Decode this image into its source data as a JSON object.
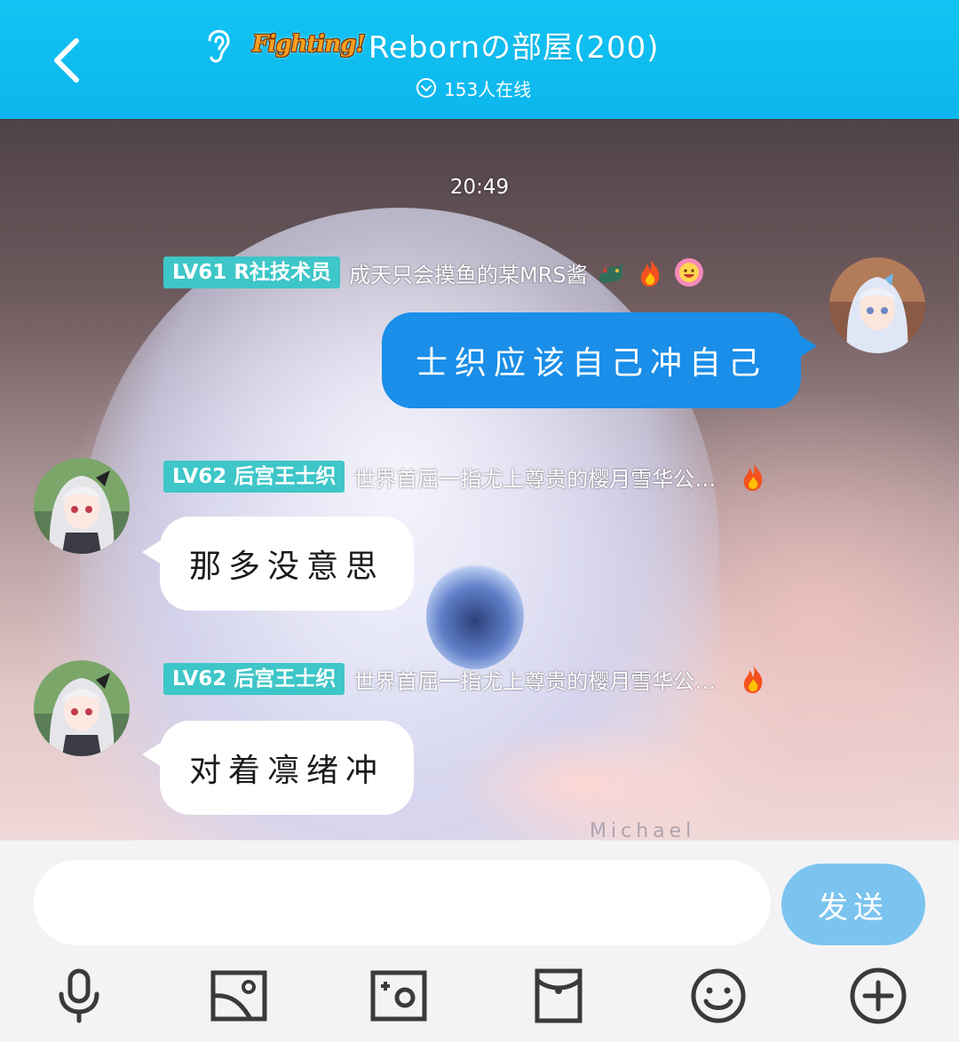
{
  "header": {
    "brand_logo_text": "Fighting!",
    "room_title": "Rebornの部屋(200)",
    "online_count": "153人在线"
  },
  "chat": {
    "timestamp": "20:49",
    "messages": [
      {
        "direction": "outgoing",
        "level": "LV61",
        "title": "R社技术员",
        "signature": "成天只会摸鱼的某MRS酱",
        "badges": [
          "dragon-icon",
          "fire-icon",
          "smile-face-icon"
        ],
        "text": "士织应该自己冲自己"
      },
      {
        "direction": "incoming",
        "level": "LV62",
        "title": "后宫王士织",
        "signature": "世界首屈一指尤上尊贵的樱月雪华公…",
        "badges": [
          "fire-icon"
        ],
        "text": "那多没意思"
      },
      {
        "direction": "incoming",
        "level": "LV62",
        "title": "后宫王士织",
        "signature": "世界首屈一指尤上尊贵的樱月雪华公…",
        "badges": [
          "fire-icon"
        ],
        "text": "对着凛绪冲"
      }
    ],
    "background_watermark": "Michael"
  },
  "composer": {
    "input_value": "",
    "send_label": "发送",
    "toolbar": [
      "microphone-icon",
      "image-icon",
      "camera-icon",
      "red-packet-icon",
      "emoji-icon",
      "plus-icon"
    ]
  },
  "colors": {
    "header": "#0cb6ee",
    "level_badge": "#3ec6c8",
    "outgoing_bubble": "#1a8ee8",
    "send_button": "#7bc4ef"
  }
}
